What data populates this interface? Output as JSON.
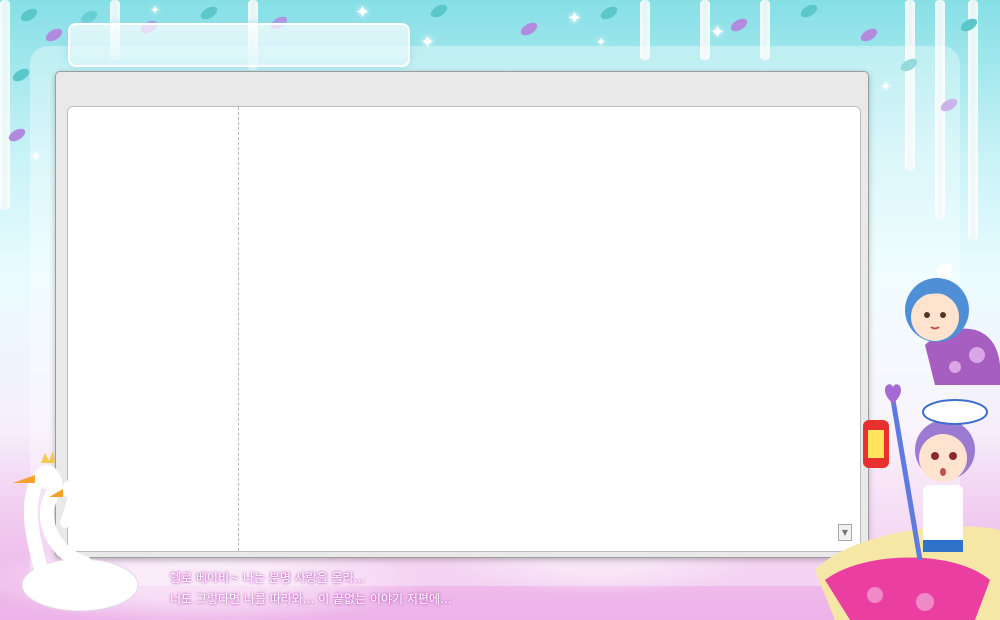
{
  "title_bar": {
    "title": ""
  },
  "book": {
    "left_page_text": "",
    "right_page_text": ""
  },
  "lyrics": {
    "line1": "헬로 베이비~ 나는 분명 사랑을 몰라...",
    "line2": "너도 그렇다면 나를 따라와... 이 끝없는 이야기 저편에..."
  },
  "icons": {
    "scroll_down": "chevron-down-icon"
  },
  "colors": {
    "sky": "#86dfe6",
    "pink_water": "#f1c7ee",
    "window_frame": "#e9e9e9",
    "lyric_glow": "#c15fc4"
  }
}
